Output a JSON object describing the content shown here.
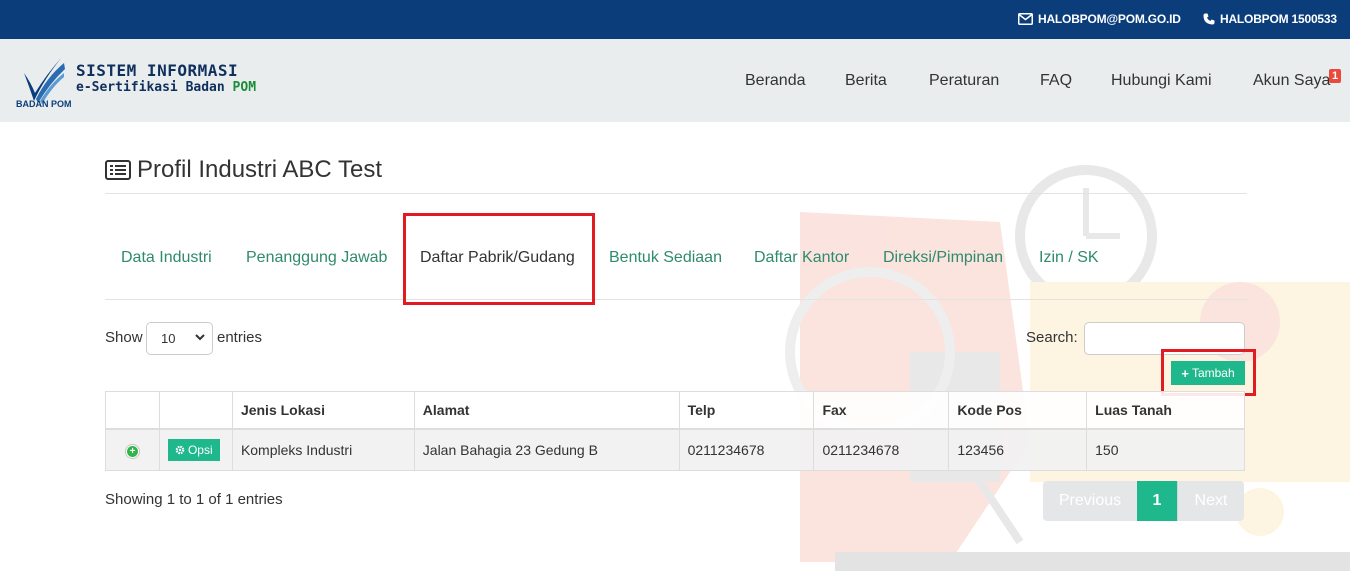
{
  "topbar": {
    "email": "HALOBPOM@POM.GO.ID",
    "phone": "HALOBPOM 1500533"
  },
  "brand": {
    "line1": "SISTEM INFORMASI",
    "line2": "e-Sertifikasi Badan ",
    "line2_highlight": "POM",
    "logo_text": "BADAN POM"
  },
  "nav": {
    "items": [
      "Beranda",
      "Berita",
      "Peraturan",
      "FAQ",
      "Hubungi Kami",
      "Akun Saya"
    ],
    "badge": "1"
  },
  "page": {
    "title": "Profil Industri ABC Test"
  },
  "tabs": [
    {
      "label": "Data Industri"
    },
    {
      "label": "Penanggung Jawab"
    },
    {
      "label": "Daftar Pabrik/Gudang",
      "active": true
    },
    {
      "label": "Bentuk Sediaan"
    },
    {
      "label": "Daftar Kantor"
    },
    {
      "label": "Direksi/Pimpinan"
    },
    {
      "label": "Izin / SK"
    }
  ],
  "controls": {
    "show_label": "Show",
    "entries_value": "10",
    "entries_label": "entries",
    "search_label": "Search:",
    "search_value": "",
    "tambah_label": "Tambah"
  },
  "table": {
    "headers": [
      "",
      "",
      "Jenis Lokasi",
      "Alamat",
      "Telp",
      "Fax",
      "Kode Pos",
      "Luas Tanah"
    ],
    "rows": [
      {
        "opsi_label": "Opsi",
        "jenis_lokasi": "Kompleks Industri",
        "alamat": "Jalan Bahagia 23 Gedung B",
        "telp": "0211234678",
        "fax": "0211234678",
        "kode_pos": "123456",
        "luas_tanah": "150"
      }
    ]
  },
  "footer": {
    "info": "Showing 1 to 1 of 1 entries",
    "prev": "Previous",
    "page": "1",
    "next": "Next"
  },
  "colors": {
    "topbar": "#0a3d7a",
    "accent": "#1fb88c",
    "tab_link": "#2f8a6e",
    "highlight": "#e21b23"
  }
}
